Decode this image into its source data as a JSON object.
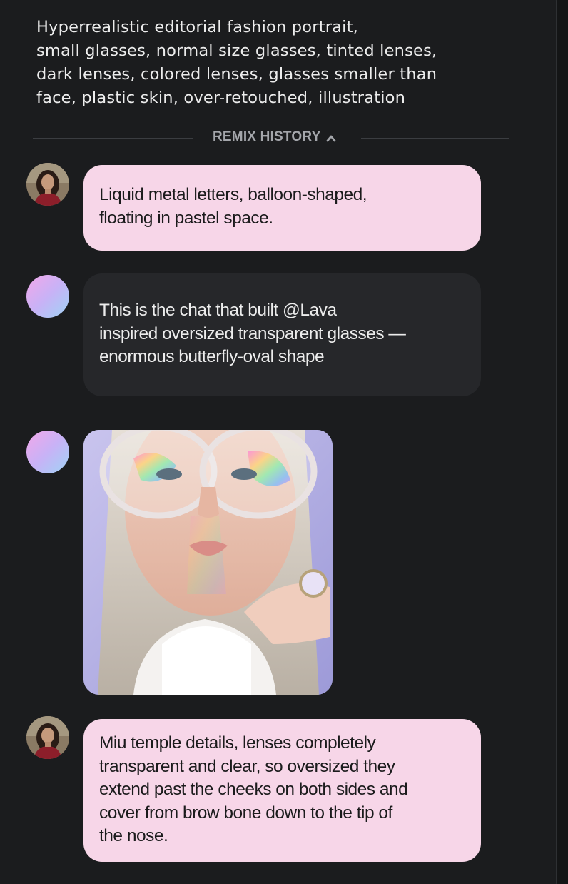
{
  "prompt": {
    "text": "Hyperrealistic editorial fashion portrait,\nsmall glasses, normal size glasses, tinted lenses,\ndark lenses, colored lenses, glasses smaller than\nface, plastic skin, over-retouched, illustration"
  },
  "remix_history": {
    "label": "REMIX HISTORY",
    "icon": "chevron-up-icon",
    "expanded": true
  },
  "messages": [
    {
      "role": "user",
      "text": "Liquid metal letters, balloon-shaped,\nfloating in pastel space."
    },
    {
      "role": "ai",
      "text": "This is the chat that built @Lava\ninspired oversized transparent glasses —\nenormous butterfly-oval shape"
    },
    {
      "role": "ai",
      "type": "image",
      "subject": "portrait with oversized transparent glasses"
    },
    {
      "role": "user",
      "text": "Miu temple details, lenses completely\ntransparent and clear, so oversized they\nextend past the cheeks on both sides and\ncover from brow bone down to the tip of\nthe nose."
    }
  ],
  "colors": {
    "background": "#141516",
    "panel": "#1b1c1e",
    "user_bubble": "#f7d6e8",
    "ai_bubble": "#26272a",
    "muted_text": "#a4a6ab"
  }
}
